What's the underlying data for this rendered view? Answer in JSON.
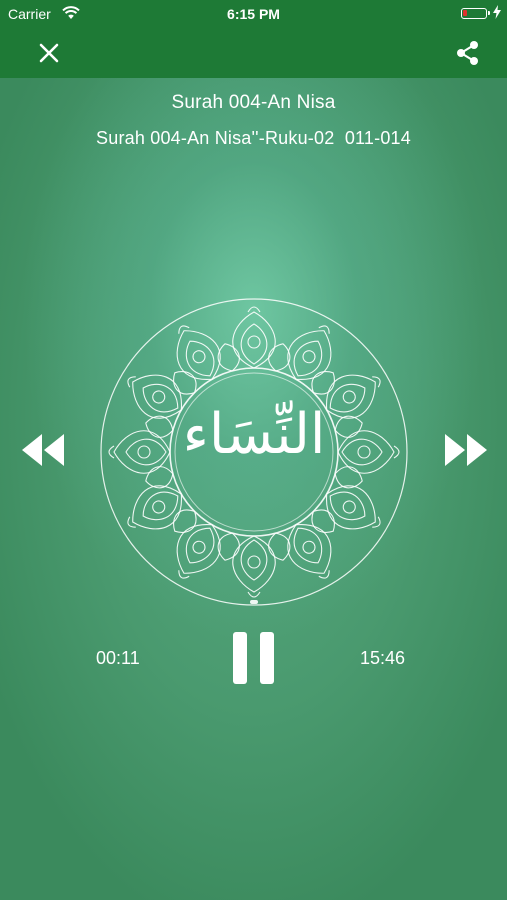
{
  "status_bar": {
    "carrier": "Carrier",
    "time": "6:15 PM",
    "battery_color": "#e0322c"
  },
  "nav": {
    "close_icon": "close-icon",
    "share_icon": "share-icon",
    "bar_color": "#1e7a36"
  },
  "track": {
    "title": "Surah 004-An Nisa",
    "subtitle": "Surah 004-An Nisa''-Ruku-02  011-014",
    "arabic_name": "النِّسَاء"
  },
  "player": {
    "elapsed": "00:11",
    "duration": "15:46",
    "progress": 0.012,
    "prev_icon": "rewind-icon",
    "play_state_icon": "pause-icon",
    "next_icon": "fast-forward-icon"
  }
}
